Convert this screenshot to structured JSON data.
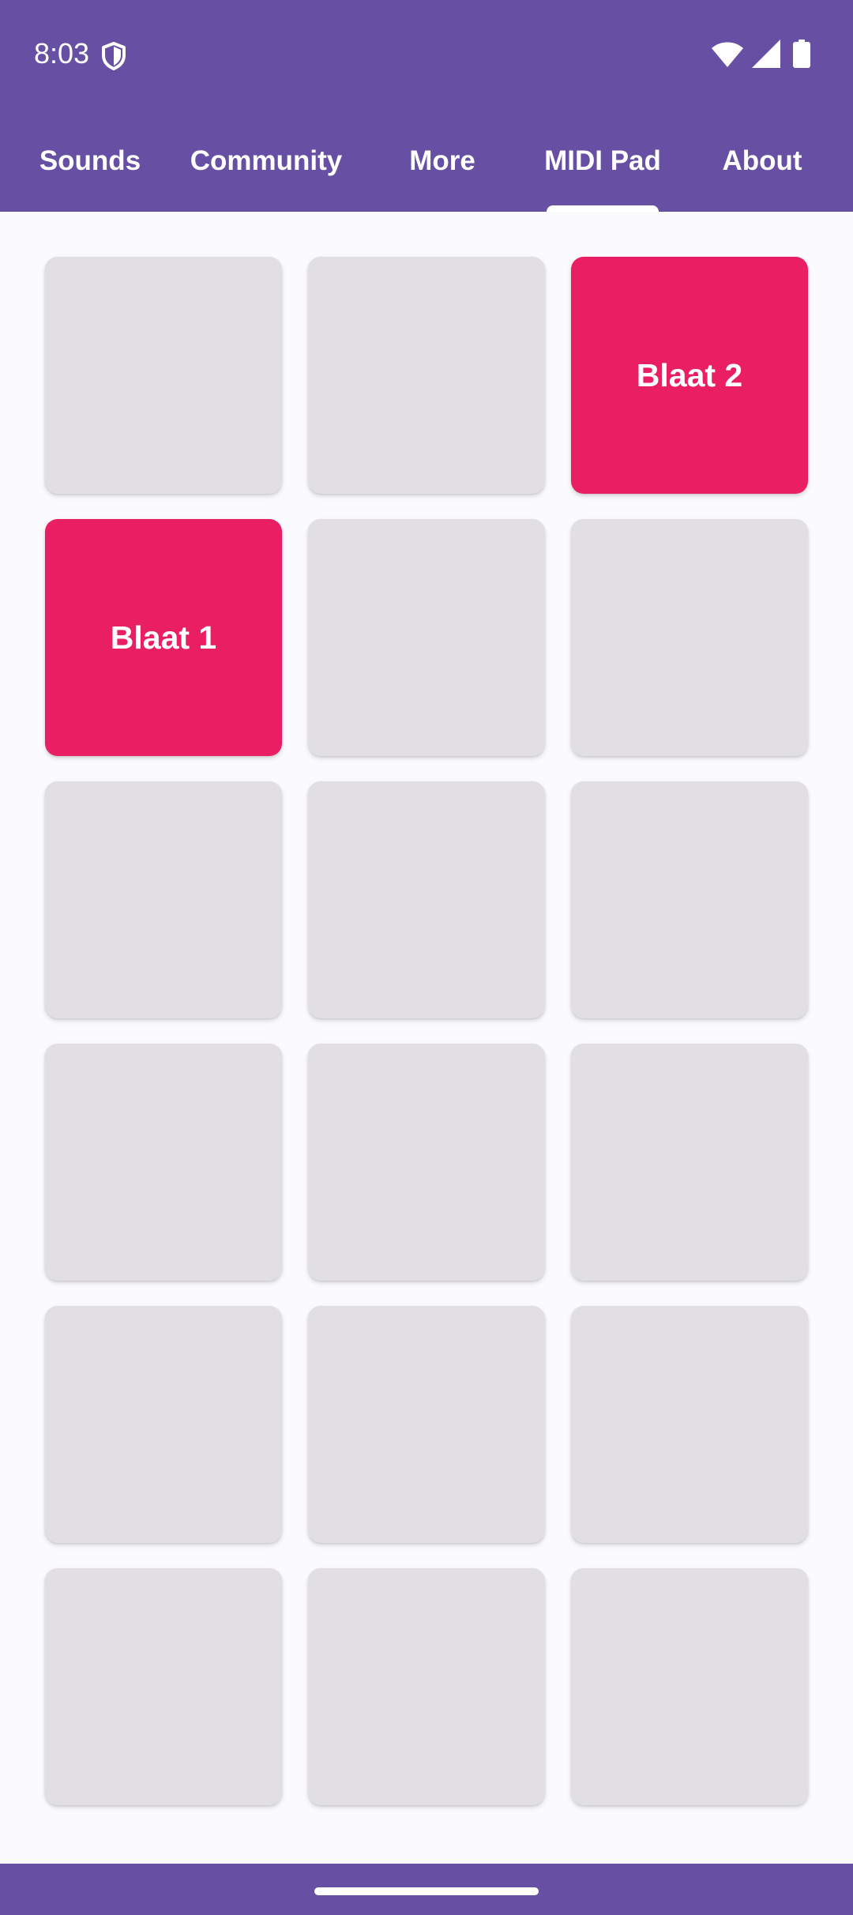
{
  "status_bar": {
    "time": "8:03",
    "icons": [
      "shield-icon",
      "wifi-icon",
      "signal-icon",
      "battery-icon"
    ]
  },
  "tabs": [
    {
      "label": "Sounds",
      "selected": false
    },
    {
      "label": "Community",
      "selected": false
    },
    {
      "label": "More",
      "selected": false
    },
    {
      "label": "MIDI Pad",
      "selected": true
    },
    {
      "label": "About",
      "selected": false
    }
  ],
  "pads": [
    {
      "label": "",
      "active": false
    },
    {
      "label": "",
      "active": false
    },
    {
      "label": "Blaat 2",
      "active": true
    },
    {
      "label": "Blaat 1",
      "active": true
    },
    {
      "label": "",
      "active": false
    },
    {
      "label": "",
      "active": false
    },
    {
      "label": "",
      "active": false
    },
    {
      "label": "",
      "active": false
    },
    {
      "label": "",
      "active": false
    },
    {
      "label": "",
      "active": false
    },
    {
      "label": "",
      "active": false
    },
    {
      "label": "",
      "active": false
    },
    {
      "label": "",
      "active": false
    },
    {
      "label": "",
      "active": false
    },
    {
      "label": "",
      "active": false
    },
    {
      "label": "",
      "active": false
    },
    {
      "label": "",
      "active": false
    },
    {
      "label": "",
      "active": false
    }
  ],
  "colors": {
    "primary": "#6750A4",
    "pad_idle": "#E1DFE2",
    "pad_active": "#E91E63",
    "on_primary": "#FFFFFF",
    "background": "#FBFAFD"
  }
}
